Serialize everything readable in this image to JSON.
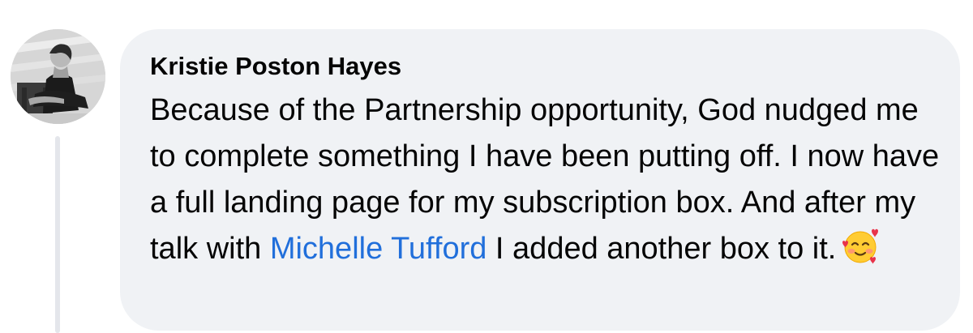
{
  "comment": {
    "author_name": "Kristie Poston Hayes",
    "text_before_mention": "Because of the Partnership opportunity, God nudged me to complete something I have been putting off. I now have a full landing page for my subscription box. And after my talk with ",
    "mention_name": "Michelle Tufford",
    "text_after_mention": " I added another box to it.",
    "emoji_icon": "smiling-face-with-hearts-icon"
  },
  "colors": {
    "bubble_background": "#f0f2f5",
    "text": "#050505",
    "mention_link": "#216fdb",
    "thread_line": "#e4e6eb"
  }
}
